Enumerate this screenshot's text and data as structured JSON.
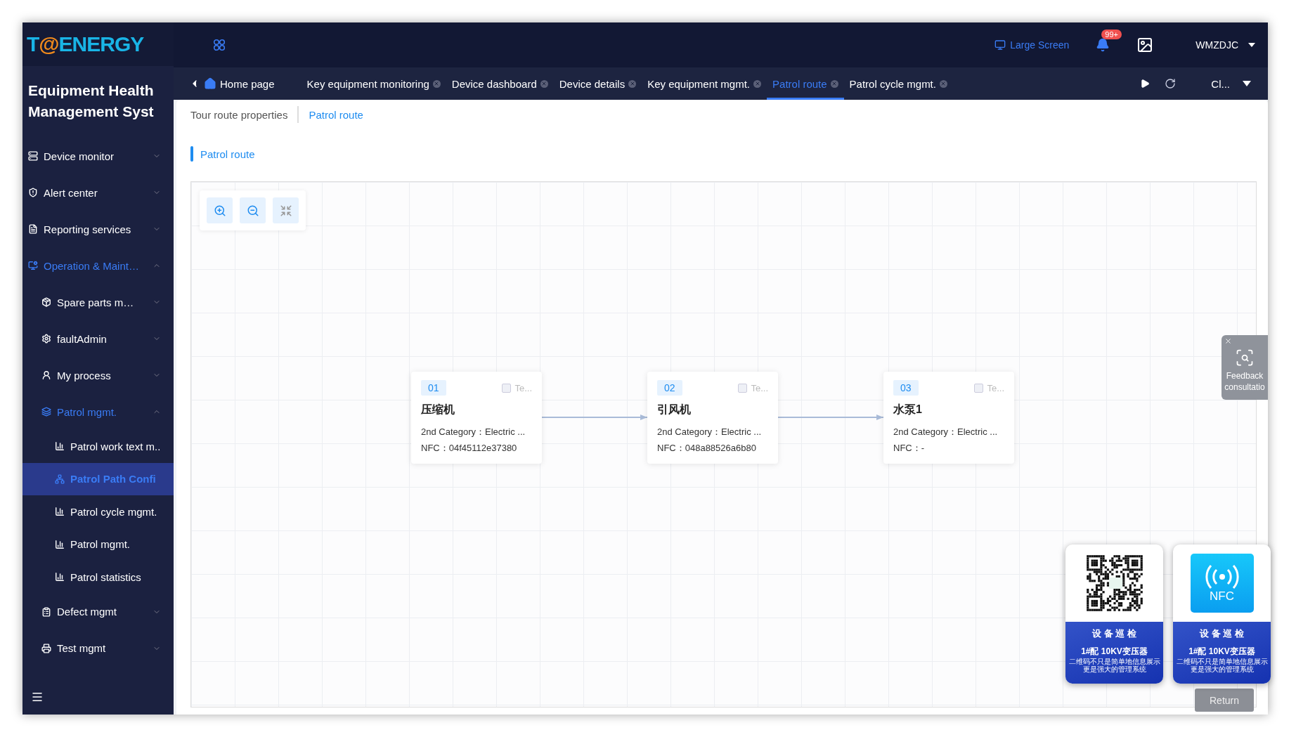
{
  "logo": {
    "parts": [
      {
        "text": "T",
        "accent": false
      },
      {
        "text": "@",
        "accent": true
      },
      {
        "text": "ENERGY",
        "accent": false
      }
    ]
  },
  "app_title": "Equipment Health Management Syst",
  "header": {
    "large_screen": "Large Screen",
    "notification_badge": "99+",
    "user": "WMZDJC"
  },
  "sidebar": {
    "items": [
      {
        "label": "Device monitor",
        "expanded": false,
        "active": false
      },
      {
        "label": "Alert center",
        "expanded": false,
        "active": false
      },
      {
        "label": "Reporting services",
        "expanded": false,
        "active": false
      },
      {
        "label": "Operation & Maint…",
        "expanded": true,
        "active": true,
        "children": [
          {
            "label": "Spare parts m…",
            "expanded": false,
            "active": false
          },
          {
            "label": "faultAdmin",
            "expanded": false,
            "active": false
          },
          {
            "label": "My process",
            "expanded": false,
            "active": false
          },
          {
            "label": "Patrol mgmt.",
            "expanded": true,
            "active": true,
            "children": [
              {
                "label": "Patrol work text m..",
                "selected": false
              },
              {
                "label": "Patrol Path Confi",
                "selected": true
              },
              {
                "label": "Patrol cycle mgmt.",
                "selected": false
              },
              {
                "label": "Patrol mgmt.",
                "selected": false
              },
              {
                "label": "Patrol statistics",
                "selected": false
              }
            ]
          },
          {
            "label": "Defect mgmt",
            "expanded": false,
            "active": false
          },
          {
            "label": "Test mgmt",
            "expanded": false,
            "active": false
          }
        ]
      }
    ]
  },
  "tabs": [
    {
      "label": "Home page",
      "kind": "home",
      "selected": false
    },
    {
      "label": "Key equipment monitoring",
      "kind": "page",
      "selected": false
    },
    {
      "label": "Device dashboard",
      "kind": "page",
      "selected": false
    },
    {
      "label": "Device details",
      "kind": "page",
      "selected": false
    },
    {
      "label": "Key equipment mgmt.",
      "kind": "page",
      "selected": false
    },
    {
      "label": "Patrol route",
      "kind": "page",
      "selected": true
    },
    {
      "label": "Patrol cycle mgmt.",
      "kind": "page",
      "selected": false
    }
  ],
  "tab_menu": "Cl...",
  "content_tabs": [
    {
      "label": "Tour route properties",
      "selected": false
    },
    {
      "label": "Patrol route",
      "selected": true
    }
  ],
  "section_title": "Patrol route",
  "nodes": [
    {
      "number": "01",
      "check_label": "Te...",
      "checked": false,
      "name": "压缩机",
      "category": "2nd Category：Electric ...",
      "nfc": "NFC：04f45112e37380"
    },
    {
      "number": "02",
      "check_label": "Te...",
      "checked": false,
      "name": "引风机",
      "category": "2nd Category：Electric ...",
      "nfc": "NFC：048a88526a6b80"
    },
    {
      "number": "03",
      "check_label": "Te...",
      "checked": false,
      "name": "水泵1",
      "category": "2nd Category：Electric ...",
      "nfc": "NFC：-"
    }
  ],
  "feedback": {
    "lines": [
      "Feedback",
      "consultatio"
    ]
  },
  "tag_cards": [
    {
      "kind": "qr",
      "title": "设 备 巡 检",
      "subtitle": "1#配 10KV变压器",
      "notes": [
        "二维码不只是简单地信息展示",
        "更是强大的管理系统"
      ]
    },
    {
      "kind": "nfc",
      "badge": "NFC",
      "title": "设 备 巡 检",
      "subtitle": "1#配 10KV变压器",
      "notes": [
        "二维码不只是简单地信息展示",
        "更是强大的管理系统"
      ]
    }
  ],
  "return_button": "Return"
}
